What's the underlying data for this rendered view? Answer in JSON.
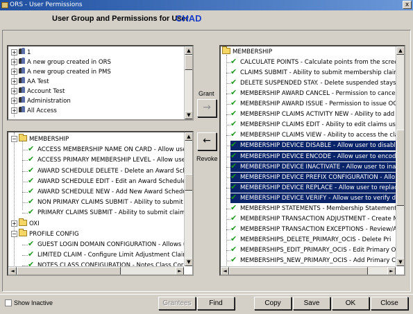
{
  "window": {
    "title": "ORS - User Permissions",
    "close_glyph": "x"
  },
  "header": {
    "label": "User Group and Permissions for User",
    "user": "CHAD"
  },
  "groups_panel": {
    "items": [
      {
        "label": "1"
      },
      {
        "label": "A new group created in ORS"
      },
      {
        "label": "A new group created in PMS"
      },
      {
        "label": "AA Test"
      },
      {
        "label": "Account Test"
      },
      {
        "label": "Administration"
      },
      {
        "label": "All Access"
      }
    ]
  },
  "available_panel": {
    "folders_before": [],
    "rows": [
      {
        "kind": "folder",
        "label": "MEMBERSHIP",
        "expanded": true
      },
      {
        "kind": "perm",
        "label": "ACCESS MEMBERSHIP NAME ON CARD - Allow use"
      },
      {
        "kind": "perm",
        "label": "ACCESS PRIMARY MEMBERSHIP LEVEL - Allow use"
      },
      {
        "kind": "perm",
        "label": "AWARD SCHEDULE DELETE - Delete an Award Sch"
      },
      {
        "kind": "perm",
        "label": "AWARD SCHEDULE EDIT - Edit an Award Schedule"
      },
      {
        "kind": "perm",
        "label": "AWARD SCHEDULE NEW - Add New Award Schedu"
      },
      {
        "kind": "perm",
        "label": "NON PRIMARY CLAIMS SUBMIT - Ability to submit m"
      },
      {
        "kind": "perm",
        "label": "PRIMARY CLAIMS SUBMIT - Ability to submit claims t"
      },
      {
        "kind": "folder",
        "label": "OXI",
        "expanded": false
      },
      {
        "kind": "folder",
        "label": "PROFILE CONFIG",
        "expanded": true
      },
      {
        "kind": "perm",
        "label": "GUEST LOGIN DOMAIN CONFIGURATION - Allows u"
      },
      {
        "kind": "perm",
        "label": "LIMITED CLAIM - Configure Limit Adjustment Claims"
      },
      {
        "kind": "perm",
        "label": "NOTES CLASS CONFIGURATION - Notes Class Cor"
      }
    ]
  },
  "granted_panel": {
    "folder": "MEMBERSHIP",
    "rows": [
      {
        "label": "CALCULATE POINTS - Calculate points from the screen",
        "selected": false
      },
      {
        "label": "CLAIMS SUBMIT - Ability to submit membership claims t",
        "selected": false
      },
      {
        "label": "DELETE SUSPENDED STAY. - Delete suspended stays",
        "selected": false
      },
      {
        "label": "MEMBERSHIP AWARD CANCEL - Permission to cancel",
        "selected": false
      },
      {
        "label": "MEMBERSHIP AWARD ISSUE - Permission to issue OC",
        "selected": false
      },
      {
        "label": "MEMBERSHIP CLAIMS ACTIVITY NEW - Ability to add ne",
        "selected": false
      },
      {
        "label": "MEMBERSHIP CLAIMS EDIT - Ability to edit claims using",
        "selected": false
      },
      {
        "label": "MEMBERSHIP CLAIMS VIEW - Ability to access the claim",
        "selected": false
      },
      {
        "label": "MEMBERSHIP DEVICE DISABLE - Allow user to disable",
        "selected": true
      },
      {
        "label": "MEMBERSHIP DEVICE ENCODE - Allow user to encode",
        "selected": true
      },
      {
        "label": "MEMBERSHIP DEVICE INACTIVATE - Allow user to inac",
        "selected": true
      },
      {
        "label": "MEMBERSHIP DEVICE PREFIX CONFIGURATION - Allo",
        "selected": true
      },
      {
        "label": "MEMBERSHIP DEVICE REPLACE - Allow user to replac",
        "selected": true
      },
      {
        "label": "MEMBERSHIP DEVICE VERIFY - Allow user to verify dev",
        "selected": true
      },
      {
        "label": "MEMBERSHIP STATEMENTS - Membership Statements",
        "selected": false
      },
      {
        "label": "MEMBERSHIP TRANSACTION ADJUSTMENT - Create M",
        "selected": false
      },
      {
        "label": "MEMBERSHIP TRANSACTION EXCEPTIONS - Review/A",
        "selected": false
      },
      {
        "label": "MEMBERSHIPS_DELETE_PRIMARY_OCIS - Delete Pri",
        "selected": false
      },
      {
        "label": "MEMBERSHIPS_EDIT_PRIMARY_OCIS - Edit Primary O",
        "selected": false
      },
      {
        "label": "MEMBERSHIPS_NEW_PRIMARY_OCIS - Add Primary C",
        "selected": false
      }
    ]
  },
  "actions": {
    "grant_label": "Grant",
    "grant_glyph": "→",
    "revoke_label": "Revoke",
    "revoke_glyph": "←"
  },
  "footer": {
    "show_inactive_label": "Show Inactive",
    "show_inactive_checked": false,
    "buttons": {
      "grantees": "Grantees",
      "find": "Find",
      "copy": "Copy",
      "save": "Save",
      "ok": "OK",
      "close": "Close"
    }
  },
  "colors": {
    "title_bar": "#1f4fa0",
    "user_name": "#1a3ec8",
    "selection": "#0a246a",
    "check": "#1a9a1a",
    "folder": "#f5d665"
  },
  "icons": {
    "group": "group-icon",
    "folder": "folder-icon",
    "permission": "check-icon"
  }
}
